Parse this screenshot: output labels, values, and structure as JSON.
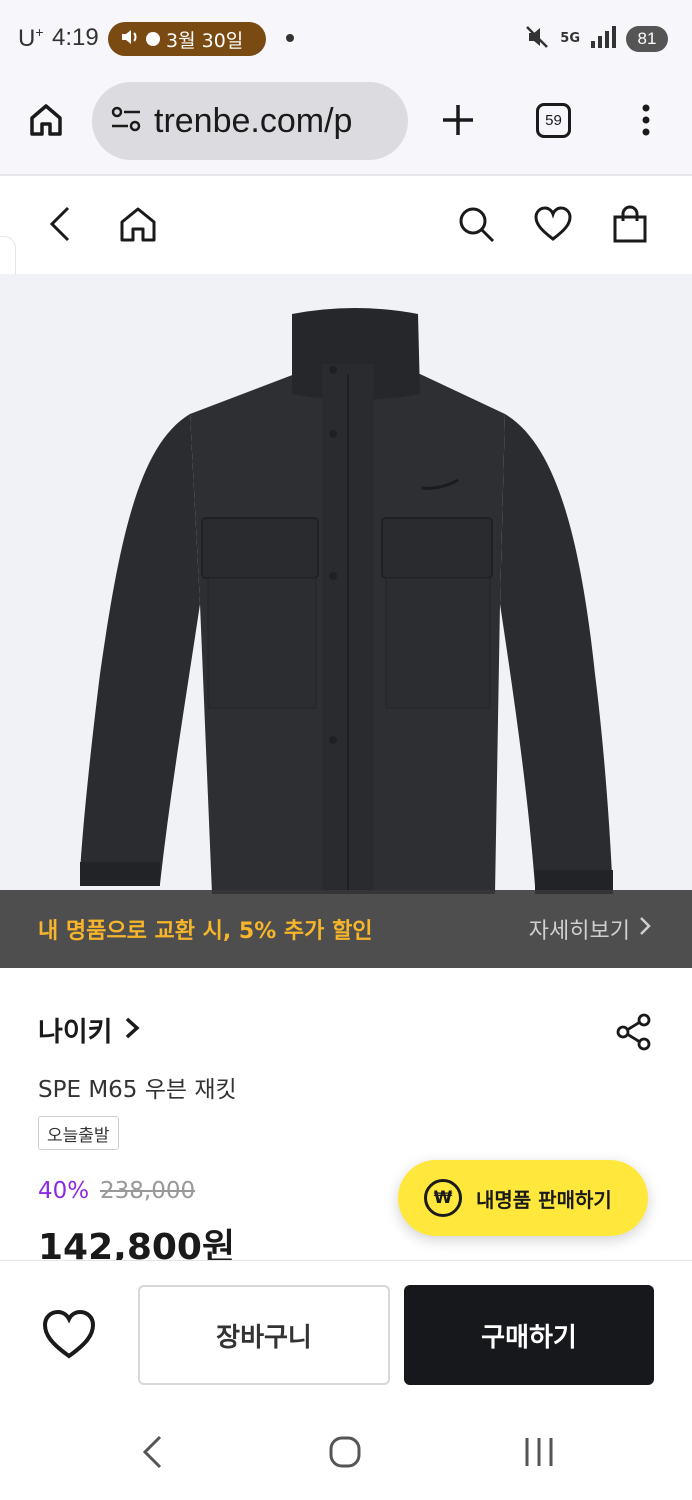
{
  "status_bar": {
    "carrier": "U",
    "carrier_sup": "+",
    "time": "4:19",
    "media_date": "3월 30일",
    "network": "5G",
    "battery": "81"
  },
  "browser": {
    "url": "trenbe.com/p",
    "tab_count": "59"
  },
  "promo": {
    "text": "내 명품으로 교환 시, 5% 추가 할인",
    "link": "자세히보기"
  },
  "product": {
    "brand": "나이키",
    "name": "SPE M65 우븐 재킷",
    "tag": "오늘출발",
    "discount": "40%",
    "original_price": "238,000",
    "final_price": "142,800원"
  },
  "sell_button": {
    "icon_label": "₩",
    "label": "내명품 판매하기"
  },
  "actions": {
    "cart_label": "장바구니",
    "buy_label": "구매하기"
  },
  "colors": {
    "promo_text": "#f6b52a",
    "discount": "#8a2be2",
    "sell_button": "#ffe83b",
    "buy_button": "#17181b"
  },
  "icons": [
    "home-icon",
    "settings-icon",
    "plus-icon",
    "more-icon",
    "back-icon",
    "search-icon",
    "heart-icon",
    "bag-icon",
    "share-icon",
    "chevron-right-icon"
  ]
}
